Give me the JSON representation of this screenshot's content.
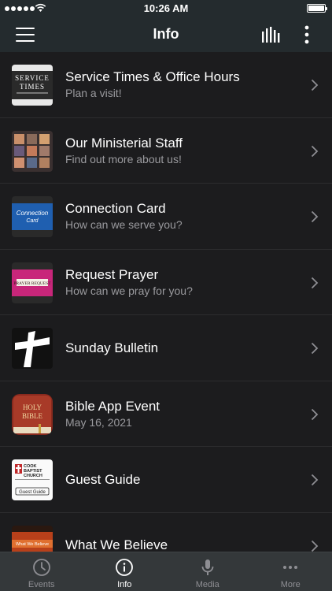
{
  "status_bar": {
    "time": "10:26 AM"
  },
  "nav": {
    "title": "Info"
  },
  "thumbs": {
    "service": [
      "SERVICE",
      "TIMES"
    ],
    "connection": [
      "Connection",
      "Card"
    ],
    "prayer": "PRAYER REQUEST",
    "bible": [
      "HOLY",
      "BIBLE"
    ],
    "guest": [
      "COOK",
      "BAPTIST",
      "CHURCH",
      "Guest Guide"
    ],
    "believe": "What We Believe"
  },
  "items": [
    {
      "title": "Service Times & Office Hours",
      "subtitle": "Plan a visit!"
    },
    {
      "title": "Our Ministerial Staff",
      "subtitle": "Find out more about us!"
    },
    {
      "title": "Connection Card",
      "subtitle": "How can we serve you?"
    },
    {
      "title": "Request Prayer",
      "subtitle": "How can we pray for you?"
    },
    {
      "title": "Sunday Bulletin",
      "subtitle": ""
    },
    {
      "title": "Bible App Event",
      "subtitle": "May 16, 2021"
    },
    {
      "title": "Guest Guide",
      "subtitle": ""
    },
    {
      "title": "What We Believe",
      "subtitle": ""
    }
  ],
  "tabs": [
    {
      "label": "Events",
      "icon": "clock-icon"
    },
    {
      "label": "Info",
      "icon": "info-icon"
    },
    {
      "label": "Media",
      "icon": "microphone-icon"
    },
    {
      "label": "More",
      "icon": "ellipsis-icon"
    }
  ],
  "colors": {
    "nav_background": "#242b2e",
    "list_background": "#1c1c1e",
    "tab_bar_background": "#34383a",
    "subtitle_text": "#9a9a9e",
    "active_tab": "#ffffff",
    "inactive_tab": "#8e8e93"
  }
}
